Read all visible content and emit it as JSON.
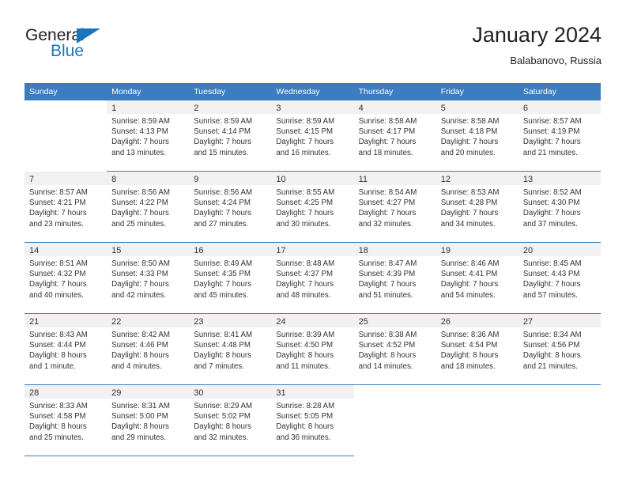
{
  "brand": {
    "word_one": "General",
    "word_two": "Blue",
    "triangle_icon": "brand-triangle-icon",
    "accent_color": "#1b75bb"
  },
  "header": {
    "title": "January 2024",
    "subtitle": "Balabanovo, Russia"
  },
  "colors": {
    "header_row_bg": "#3a7dc0",
    "day_number_bg": "#f1f1f1",
    "text": "#333333"
  },
  "weekday_headers": [
    "Sunday",
    "Monday",
    "Tuesday",
    "Wednesday",
    "Thursday",
    "Friday",
    "Saturday"
  ],
  "labels": {
    "sunrise_prefix": "Sunrise:",
    "sunset_prefix": "Sunset:",
    "daylight_prefix": "Daylight:"
  },
  "weeks": [
    [
      {
        "day": "",
        "sunrise": "",
        "sunset": "",
        "daylight_line1": "",
        "daylight_line2": ""
      },
      {
        "day": "1",
        "sunrise": "Sunrise: 8:59 AM",
        "sunset": "Sunset: 4:13 PM",
        "daylight_line1": "Daylight: 7 hours",
        "daylight_line2": "and 13 minutes."
      },
      {
        "day": "2",
        "sunrise": "Sunrise: 8:59 AM",
        "sunset": "Sunset: 4:14 PM",
        "daylight_line1": "Daylight: 7 hours",
        "daylight_line2": "and 15 minutes."
      },
      {
        "day": "3",
        "sunrise": "Sunrise: 8:59 AM",
        "sunset": "Sunset: 4:15 PM",
        "daylight_line1": "Daylight: 7 hours",
        "daylight_line2": "and 16 minutes."
      },
      {
        "day": "4",
        "sunrise": "Sunrise: 8:58 AM",
        "sunset": "Sunset: 4:17 PM",
        "daylight_line1": "Daylight: 7 hours",
        "daylight_line2": "and 18 minutes."
      },
      {
        "day": "5",
        "sunrise": "Sunrise: 8:58 AM",
        "sunset": "Sunset: 4:18 PM",
        "daylight_line1": "Daylight: 7 hours",
        "daylight_line2": "and 20 minutes."
      },
      {
        "day": "6",
        "sunrise": "Sunrise: 8:57 AM",
        "sunset": "Sunset: 4:19 PM",
        "daylight_line1": "Daylight: 7 hours",
        "daylight_line2": "and 21 minutes."
      }
    ],
    [
      {
        "day": "7",
        "sunrise": "Sunrise: 8:57 AM",
        "sunset": "Sunset: 4:21 PM",
        "daylight_line1": "Daylight: 7 hours",
        "daylight_line2": "and 23 minutes."
      },
      {
        "day": "8",
        "sunrise": "Sunrise: 8:56 AM",
        "sunset": "Sunset: 4:22 PM",
        "daylight_line1": "Daylight: 7 hours",
        "daylight_line2": "and 25 minutes."
      },
      {
        "day": "9",
        "sunrise": "Sunrise: 8:56 AM",
        "sunset": "Sunset: 4:24 PM",
        "daylight_line1": "Daylight: 7 hours",
        "daylight_line2": "and 27 minutes."
      },
      {
        "day": "10",
        "sunrise": "Sunrise: 8:55 AM",
        "sunset": "Sunset: 4:25 PM",
        "daylight_line1": "Daylight: 7 hours",
        "daylight_line2": "and 30 minutes."
      },
      {
        "day": "11",
        "sunrise": "Sunrise: 8:54 AM",
        "sunset": "Sunset: 4:27 PM",
        "daylight_line1": "Daylight: 7 hours",
        "daylight_line2": "and 32 minutes."
      },
      {
        "day": "12",
        "sunrise": "Sunrise: 8:53 AM",
        "sunset": "Sunset: 4:28 PM",
        "daylight_line1": "Daylight: 7 hours",
        "daylight_line2": "and 34 minutes."
      },
      {
        "day": "13",
        "sunrise": "Sunrise: 8:52 AM",
        "sunset": "Sunset: 4:30 PM",
        "daylight_line1": "Daylight: 7 hours",
        "daylight_line2": "and 37 minutes."
      }
    ],
    [
      {
        "day": "14",
        "sunrise": "Sunrise: 8:51 AM",
        "sunset": "Sunset: 4:32 PM",
        "daylight_line1": "Daylight: 7 hours",
        "daylight_line2": "and 40 minutes."
      },
      {
        "day": "15",
        "sunrise": "Sunrise: 8:50 AM",
        "sunset": "Sunset: 4:33 PM",
        "daylight_line1": "Daylight: 7 hours",
        "daylight_line2": "and 42 minutes."
      },
      {
        "day": "16",
        "sunrise": "Sunrise: 8:49 AM",
        "sunset": "Sunset: 4:35 PM",
        "daylight_line1": "Daylight: 7 hours",
        "daylight_line2": "and 45 minutes."
      },
      {
        "day": "17",
        "sunrise": "Sunrise: 8:48 AM",
        "sunset": "Sunset: 4:37 PM",
        "daylight_line1": "Daylight: 7 hours",
        "daylight_line2": "and 48 minutes."
      },
      {
        "day": "18",
        "sunrise": "Sunrise: 8:47 AM",
        "sunset": "Sunset: 4:39 PM",
        "daylight_line1": "Daylight: 7 hours",
        "daylight_line2": "and 51 minutes."
      },
      {
        "day": "19",
        "sunrise": "Sunrise: 8:46 AM",
        "sunset": "Sunset: 4:41 PM",
        "daylight_line1": "Daylight: 7 hours",
        "daylight_line2": "and 54 minutes."
      },
      {
        "day": "20",
        "sunrise": "Sunrise: 8:45 AM",
        "sunset": "Sunset: 4:43 PM",
        "daylight_line1": "Daylight: 7 hours",
        "daylight_line2": "and 57 minutes."
      }
    ],
    [
      {
        "day": "21",
        "sunrise": "Sunrise: 8:43 AM",
        "sunset": "Sunset: 4:44 PM",
        "daylight_line1": "Daylight: 8 hours",
        "daylight_line2": "and 1 minute."
      },
      {
        "day": "22",
        "sunrise": "Sunrise: 8:42 AM",
        "sunset": "Sunset: 4:46 PM",
        "daylight_line1": "Daylight: 8 hours",
        "daylight_line2": "and 4 minutes."
      },
      {
        "day": "23",
        "sunrise": "Sunrise: 8:41 AM",
        "sunset": "Sunset: 4:48 PM",
        "daylight_line1": "Daylight: 8 hours",
        "daylight_line2": "and 7 minutes."
      },
      {
        "day": "24",
        "sunrise": "Sunrise: 8:39 AM",
        "sunset": "Sunset: 4:50 PM",
        "daylight_line1": "Daylight: 8 hours",
        "daylight_line2": "and 11 minutes."
      },
      {
        "day": "25",
        "sunrise": "Sunrise: 8:38 AM",
        "sunset": "Sunset: 4:52 PM",
        "daylight_line1": "Daylight: 8 hours",
        "daylight_line2": "and 14 minutes."
      },
      {
        "day": "26",
        "sunrise": "Sunrise: 8:36 AM",
        "sunset": "Sunset: 4:54 PM",
        "daylight_line1": "Daylight: 8 hours",
        "daylight_line2": "and 18 minutes."
      },
      {
        "day": "27",
        "sunrise": "Sunrise: 8:34 AM",
        "sunset": "Sunset: 4:56 PM",
        "daylight_line1": "Daylight: 8 hours",
        "daylight_line2": "and 21 minutes."
      }
    ],
    [
      {
        "day": "28",
        "sunrise": "Sunrise: 8:33 AM",
        "sunset": "Sunset: 4:58 PM",
        "daylight_line1": "Daylight: 8 hours",
        "daylight_line2": "and 25 minutes."
      },
      {
        "day": "29",
        "sunrise": "Sunrise: 8:31 AM",
        "sunset": "Sunset: 5:00 PM",
        "daylight_line1": "Daylight: 8 hours",
        "daylight_line2": "and 29 minutes."
      },
      {
        "day": "30",
        "sunrise": "Sunrise: 8:29 AM",
        "sunset": "Sunset: 5:02 PM",
        "daylight_line1": "Daylight: 8 hours",
        "daylight_line2": "and 32 minutes."
      },
      {
        "day": "31",
        "sunrise": "Sunrise: 8:28 AM",
        "sunset": "Sunset: 5:05 PM",
        "daylight_line1": "Daylight: 8 hours",
        "daylight_line2": "and 36 minutes."
      },
      {
        "day": "",
        "sunrise": "",
        "sunset": "",
        "daylight_line1": "",
        "daylight_line2": ""
      },
      {
        "day": "",
        "sunrise": "",
        "sunset": "",
        "daylight_line1": "",
        "daylight_line2": ""
      },
      {
        "day": "",
        "sunrise": "",
        "sunset": "",
        "daylight_line1": "",
        "daylight_line2": ""
      }
    ]
  ]
}
